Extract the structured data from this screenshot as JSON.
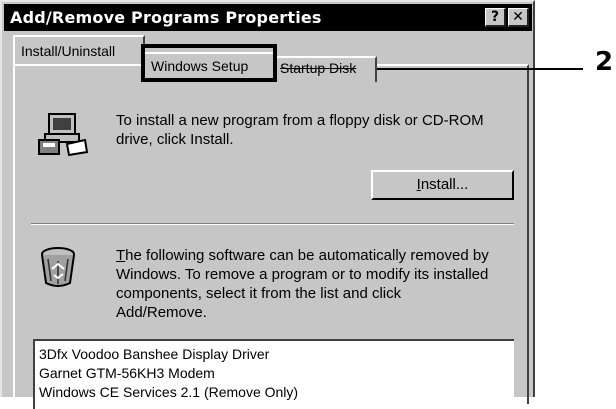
{
  "window": {
    "title": "Add/Remove Programs Properties",
    "help_button": "?",
    "close_button": "✕"
  },
  "tabs": [
    {
      "label": "Install/Uninstall",
      "active": true
    },
    {
      "label": "Windows Setup",
      "active": false
    },
    {
      "label": "Startup Disk",
      "active": false
    }
  ],
  "callout": {
    "number": "2"
  },
  "install": {
    "text_line1": "To install a new program from a floppy disk or CD-ROM",
    "text_line2": "drive, click Install.",
    "button_mnemonic": "I",
    "button_rest": "nstall..."
  },
  "remove": {
    "text_mnemonic": "T",
    "text_line1_rest": "he following software can be automatically removed by",
    "text_line2": "Windows. To remove a program or to modify its installed",
    "text_line3": "components, select it from the list and click",
    "text_line4": "Add/Remove."
  },
  "software_list": [
    "3Dfx Voodoo Banshee Display Driver",
    "Garnet GTM-56KH3 Modem",
    "Windows CE Services 2.1 (Remove Only)"
  ],
  "icons": {
    "install": "computer-install-icon",
    "remove": "recycle-bin-icon"
  }
}
